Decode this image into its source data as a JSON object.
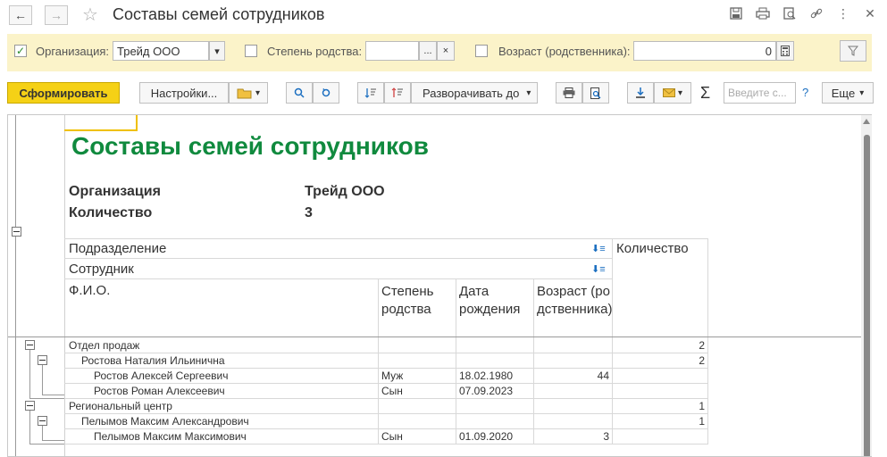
{
  "window": {
    "title": "Составы семей сотрудников"
  },
  "filters": {
    "organization_label": "Организация:",
    "organization_value": "Трейд ООО",
    "relation_label": "Степень родства:",
    "relation_value": "",
    "age_label": "Возраст (родственника):",
    "age_value": "0"
  },
  "toolbar": {
    "generate": "Сформировать",
    "settings": "Настройки...",
    "expand_to": "Разворачивать до",
    "search_placeholder": "Введите с...",
    "help": "?",
    "more": "Еще"
  },
  "report": {
    "title": "Составы семей сотрудников",
    "params": [
      {
        "name": "Организация",
        "value": "Трейд ООО"
      },
      {
        "name": "Количество",
        "value": "3"
      }
    ],
    "headers": {
      "subdivision": "Подразделение",
      "employee": "Сотрудник",
      "fio": "Ф.И.О.",
      "relation": "Степень родства",
      "birthdate": "Дата рождения",
      "age": "Возраст (родственника)",
      "count": "Количество"
    },
    "rows": [
      {
        "level": 0,
        "name": "Отдел продаж",
        "relation": "",
        "birthdate": "",
        "age": "",
        "count": "2"
      },
      {
        "level": 1,
        "name": "Ростова Наталия Ильинична",
        "relation": "",
        "birthdate": "",
        "age": "",
        "count": "2"
      },
      {
        "level": 2,
        "name": "Ростов Алексей Сергеевич",
        "relation": "Муж",
        "birthdate": "18.02.1980",
        "age": "44",
        "count": ""
      },
      {
        "level": 2,
        "name": "Ростов Роман Алексеевич",
        "relation": "Сын",
        "birthdate": "07.09.2023",
        "age": "",
        "count": ""
      },
      {
        "level": 0,
        "name": "Региональный центр",
        "relation": "",
        "birthdate": "",
        "age": "",
        "count": "1"
      },
      {
        "level": 1,
        "name": "Пелымов Максим Александрович",
        "relation": "",
        "birthdate": "",
        "age": "",
        "count": "1"
      },
      {
        "level": 2,
        "name": "Пелымов Максим Максимович",
        "relation": "Сын",
        "birthdate": "01.09.2020",
        "age": "3",
        "count": ""
      }
    ]
  }
}
